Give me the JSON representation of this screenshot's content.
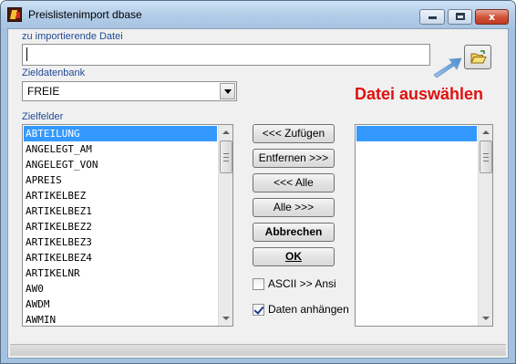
{
  "window": {
    "title": "Preislistenimport dbase",
    "close_glyph": "x"
  },
  "file": {
    "label": "zu importierende Datei",
    "value": ""
  },
  "db": {
    "label": "Zieldatenbank",
    "selected": "FREIE"
  },
  "callout": "Datei auswählen",
  "fields": {
    "label": "Zielfelder",
    "items": [
      "ABTEILUNG",
      "ANGELEGT_AM",
      "ANGELEGT_VON",
      "APREIS",
      "ARTIKELBEZ",
      "ARTIKELBEZ1",
      "ARTIKELBEZ2",
      "ARTIKELBEZ3",
      "ARTIKELBEZ4",
      "ARTIKELNR",
      "AW0",
      "AWDM",
      "AWMIN"
    ],
    "selected_index": 0
  },
  "target_list": {
    "items": [
      ""
    ],
    "selected_index": 0
  },
  "buttons": {
    "add": "<<< Zufügen",
    "remove": "Entfernen >>>",
    "all_left": "<<< Alle",
    "all_right": "Alle >>>",
    "cancel": "Abbrechen",
    "ok": "OK"
  },
  "options": {
    "ascii": {
      "label": "ASCII >> Ansi",
      "checked": false
    },
    "append": {
      "label": "Daten anhängen",
      "checked": true
    }
  },
  "icons": {
    "app": "app-icon",
    "folder": "open-folder-icon",
    "arrow": "pointer-arrow-icon"
  },
  "colors": {
    "selection": "#3399ff",
    "callout": "#e01010",
    "label": "#1f4a96"
  }
}
